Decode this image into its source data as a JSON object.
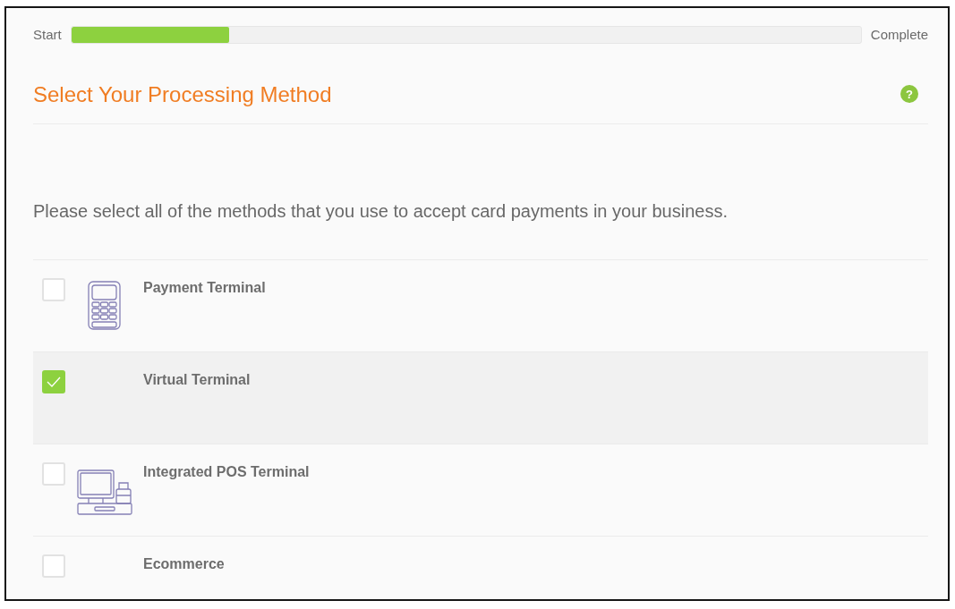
{
  "progress": {
    "start_label": "Start",
    "level": 0.2,
    "end_label": "Complete"
  },
  "header": {
    "title": "Select Your Processing Method",
    "help": "?"
  },
  "instruction": "Please select all of the methods that you use to accept card payments in your business.",
  "methods": [
    {
      "kind": "terminal",
      "label": "Payment Terminal",
      "checked": false
    },
    {
      "kind": "virtual",
      "label": "Virtual Terminal",
      "checked": true
    },
    {
      "kind": "pos",
      "label": "Integrated POS Terminal",
      "checked": false
    },
    {
      "kind": "ecommerce",
      "label": "Ecommerce",
      "checked": false
    }
  ]
}
